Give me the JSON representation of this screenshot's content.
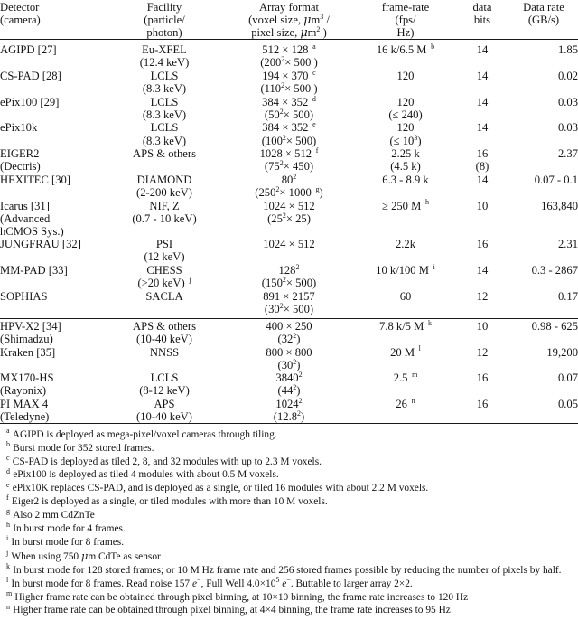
{
  "table": {
    "headers": [
      {
        "lines": [
          "Detector",
          "(camera)"
        ],
        "align": "left"
      },
      {
        "lines": [
          "Facility",
          "(particle/",
          "photon)"
        ],
        "align": "center"
      },
      {
        "lines": [
          "Array format",
          "(voxel size, μm³ /",
          "pixel size, μm² )"
        ],
        "align": "center"
      },
      {
        "lines": [
          "frame-rate",
          "(fps/",
          "Hz)"
        ],
        "align": "center"
      },
      {
        "lines": [
          "data",
          "bits"
        ],
        "align": "center"
      },
      {
        "lines": [
          "Data rate",
          "(GB/s)"
        ],
        "align": "center"
      }
    ],
    "rows": [
      {
        "detector": [
          "AGIPD [27]"
        ],
        "facility": [
          "Eu-XFEL",
          "(12.4 keV)"
        ],
        "array": [
          "512 × 128 ᵃ",
          "(200²× 500 )"
        ],
        "frame_rate": [
          "16 k/6.5 M ᵇ"
        ],
        "data_bits": [
          "14"
        ],
        "data_rate": [
          "1.85"
        ]
      },
      {
        "detector": [
          "CS-PAD [28]"
        ],
        "facility": [
          "LCLS",
          "(8.3 keV)"
        ],
        "array": [
          "194 × 370 ᶜ",
          "(110²× 500 )"
        ],
        "frame_rate": [
          "120"
        ],
        "data_bits": [
          "14"
        ],
        "data_rate": [
          "0.02"
        ]
      },
      {
        "detector": [
          "ePix100 [29]"
        ],
        "facility": [
          "LCLS",
          "(8.3 keV)"
        ],
        "array": [
          "384 × 352 ᵈ",
          "(50²× 500)"
        ],
        "frame_rate": [
          "120",
          "(≤ 240)"
        ],
        "data_bits": [
          "14"
        ],
        "data_rate": [
          "0.03"
        ]
      },
      {
        "detector": [
          "ePix10k"
        ],
        "facility": [
          "LCLS",
          "(8.3 keV)"
        ],
        "array": [
          "384 × 352 ᵉ",
          "(100²× 500)"
        ],
        "frame_rate": [
          "120",
          "(≤ 10³)"
        ],
        "data_bits": [
          "14"
        ],
        "data_rate": [
          "0.03"
        ]
      },
      {
        "detector": [
          "EIGER2",
          "(Dectris)"
        ],
        "facility": [
          "APS & others"
        ],
        "array": [
          "1028 × 512 ᶠ",
          "(75²× 450)"
        ],
        "frame_rate": [
          "2.25 k",
          "(4.5 k)"
        ],
        "data_bits": [
          "16",
          "(8)"
        ],
        "data_rate": [
          "2.37"
        ]
      },
      {
        "detector": [
          "HEXITEC [30]"
        ],
        "facility": [
          "DIAMOND",
          "(2-200 keV)"
        ],
        "array": [
          "80²",
          "(250²× 1000 ᵍ)"
        ],
        "frame_rate": [
          "6.3 - 8.9 k"
        ],
        "data_bits": [
          "14"
        ],
        "data_rate": [
          "0.07 - 0.1"
        ]
      },
      {
        "detector": [
          "Icarus [31]",
          "(Advanced",
          "hCMOS Sys.)"
        ],
        "facility": [
          "NIF, Z",
          "(0.7 - 10 keV)"
        ],
        "array": [
          "1024 × 512",
          "(25²× 25)"
        ],
        "frame_rate": [
          "≥ 250 M ʰ"
        ],
        "data_bits": [
          "10"
        ],
        "data_rate": [
          "163,840"
        ]
      },
      {
        "detector": [
          "JUNGFRAU [32]"
        ],
        "facility": [
          "PSI",
          "(12 keV)"
        ],
        "array": [
          "1024 × 512"
        ],
        "frame_rate": [
          "2.2k"
        ],
        "data_bits": [
          "16"
        ],
        "data_rate": [
          "2.31"
        ]
      },
      {
        "detector": [
          "MM-PAD [33]"
        ],
        "facility": [
          "CHESS",
          "(>20 keV) ʲ"
        ],
        "array": [
          "128²",
          "(150²× 500)"
        ],
        "frame_rate": [
          "10 k/100 M ⁱ"
        ],
        "data_bits": [
          "14"
        ],
        "data_rate": [
          "0.3 - 2867"
        ]
      },
      {
        "detector": [
          "SOPHIAS"
        ],
        "facility": [
          "SACLA"
        ],
        "array": [
          "891 × 2157",
          "(30²× 500)"
        ],
        "frame_rate": [
          "60"
        ],
        "data_bits": [
          "12"
        ],
        "data_rate": [
          "0.17"
        ]
      },
      {
        "detector": [
          "HPV-X2 [34]",
          "(Shimadzu)"
        ],
        "facility": [
          "APS & others",
          "(10-40 keV)"
        ],
        "array": [
          "400 × 250",
          "(32²)"
        ],
        "frame_rate": [
          "7.8 k/5 M ᵏ"
        ],
        "data_bits": [
          "10"
        ],
        "data_rate": [
          "0.98 - 625"
        ]
      },
      {
        "detector": [
          "Kraken [35]"
        ],
        "facility": [
          "NNSS"
        ],
        "array": [
          "800 × 800",
          "(30²)"
        ],
        "frame_rate": [
          "20 M ˡ"
        ],
        "data_bits": [
          "12"
        ],
        "data_rate": [
          "19,200"
        ]
      },
      {
        "detector": [
          "MX170-HS",
          "(Rayonix)"
        ],
        "facility": [
          "LCLS",
          "(8-12 keV)"
        ],
        "array": [
          "3840²",
          "(44²)"
        ],
        "frame_rate": [
          "2.5 ᵐ"
        ],
        "data_bits": [
          "16"
        ],
        "data_rate": [
          "0.07"
        ]
      },
      {
        "detector": [
          "PI MAX 4",
          "(Teledyne)"
        ],
        "facility": [
          "APS",
          "(10-40 keV)"
        ],
        "array": [
          "1024²",
          "(12.8²)"
        ],
        "frame_rate": [
          "26 ⁿ"
        ],
        "data_bits": [
          "16"
        ],
        "data_rate": [
          "0.05"
        ]
      }
    ]
  },
  "footnotes": [
    {
      "mark": "a",
      "text": "AGIPD is deployed as mega-pixel/voxel cameras through tiling."
    },
    {
      "mark": "b",
      "text": "Burst mode for 352 stored frames."
    },
    {
      "mark": "c",
      "text": "CS-PAD is deployed as tiled 2, 8, and 32 modules with up to 2.3 M voxels."
    },
    {
      "mark": "d",
      "text": "ePix100 is deployed as tiled 4 modules with about 0.5 M voxels."
    },
    {
      "mark": "e",
      "text": "ePix10K replaces CS-PAD, and is deployed as a single, or tiled 16 modules with about 2.2 M voxels."
    },
    {
      "mark": "f",
      "text": "Eiger2 is deployed as a single, or tiled modules with more than 10 M voxels."
    },
    {
      "mark": "g",
      "text": "Also 2 mm CdZnTe"
    },
    {
      "mark": "h",
      "text": "In burst mode for 4 frames."
    },
    {
      "mark": "i",
      "text": "In burst mode for 8 frames."
    },
    {
      "mark": "j",
      "text": "When using 750 μm CdTe as sensor"
    },
    {
      "mark": "k",
      "text": "In burst mode for 128 stored frames; or 10 M Hz frame rate and 256 stored frames possible by reducing the number of pixels by half."
    },
    {
      "mark": "l",
      "text": "In burst mode for 8 frames. Read noise 157 e⁻, Full Well 4.0×10⁵ e⁻. Buttable to larger array 2×2."
    },
    {
      "mark": "m",
      "text": "Higher frame rate can be obtained through pixel binning, at 10×10 binning, the frame rate increases to 120 Hz"
    },
    {
      "mark": "n",
      "text": "Higher frame rate can be obtained through pixel binning, at 4×4 binning, the frame rate increases to 95 Hz"
    }
  ]
}
